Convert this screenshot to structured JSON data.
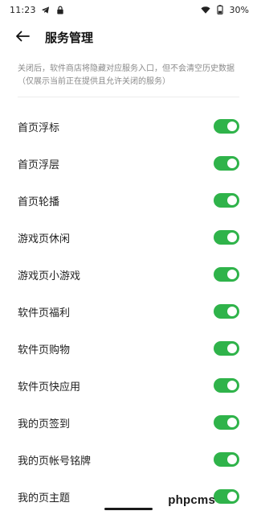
{
  "status_bar": {
    "time": "11:23",
    "left_icons": [
      "telegram-icon",
      "lock-icon"
    ],
    "wifi_icon": "wifi-icon",
    "battery_icon": "battery-icon",
    "battery_percent": "30%"
  },
  "header": {
    "back_icon": "arrow-left-icon",
    "title": "服务管理"
  },
  "description": "关闭后，软件商店将隐藏对应服务入口，但不会清空历史数据（仅展示当前正在提供且允许关闭的服务）",
  "colors": {
    "toggle_on": "#2fb34a",
    "text_primary": "#1f1f1f",
    "text_secondary": "#8a8a8a"
  },
  "settings": [
    {
      "label": "首页浮标",
      "enabled": true
    },
    {
      "label": "首页浮层",
      "enabled": true
    },
    {
      "label": "首页轮播",
      "enabled": true
    },
    {
      "label": "游戏页休闲",
      "enabled": true
    },
    {
      "label": "游戏页小游戏",
      "enabled": true
    },
    {
      "label": "软件页福利",
      "enabled": true
    },
    {
      "label": "软件页购物",
      "enabled": true
    },
    {
      "label": "软件页快应用",
      "enabled": true
    },
    {
      "label": "我的页签到",
      "enabled": true
    },
    {
      "label": "我的页帐号铭牌",
      "enabled": true
    },
    {
      "label": "我的页主题",
      "enabled": true
    }
  ],
  "watermark": "phpcms"
}
